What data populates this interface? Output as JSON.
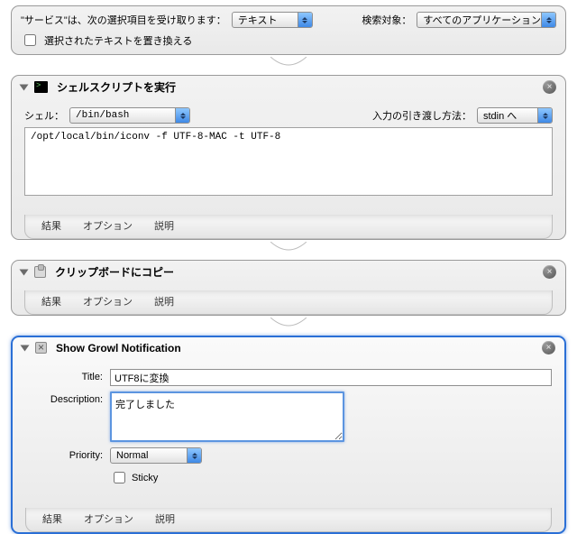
{
  "service": {
    "intro": "\"サービス\"は、次の選択項目を受け取ります：",
    "input_type": "テキスト",
    "search_label": "検索対象：",
    "search_scope": "すべてのアプリケーション",
    "replace_checkbox": "選択されたテキストを置き換える"
  },
  "shell": {
    "title": "シェルスクリプトを実行",
    "shell_label": "シェル：",
    "shell_value": "/bin/bash",
    "pass_label": "入力の引き渡し方法：",
    "pass_value": "stdin へ",
    "script": "/opt/local/bin/iconv -f UTF-8-MAC -t UTF-8"
  },
  "clipboard": {
    "title": "クリップボードにコピー"
  },
  "growl": {
    "title": "Show Growl Notification",
    "title_label": "Title:",
    "title_value": "UTF8に変換",
    "desc_label": "Description:",
    "desc_value": "完了しました",
    "priority_label": "Priority:",
    "priority_value": "Normal",
    "sticky_label": "Sticky"
  },
  "tabs": {
    "results": "結果",
    "options": "オプション",
    "description": "説明"
  }
}
